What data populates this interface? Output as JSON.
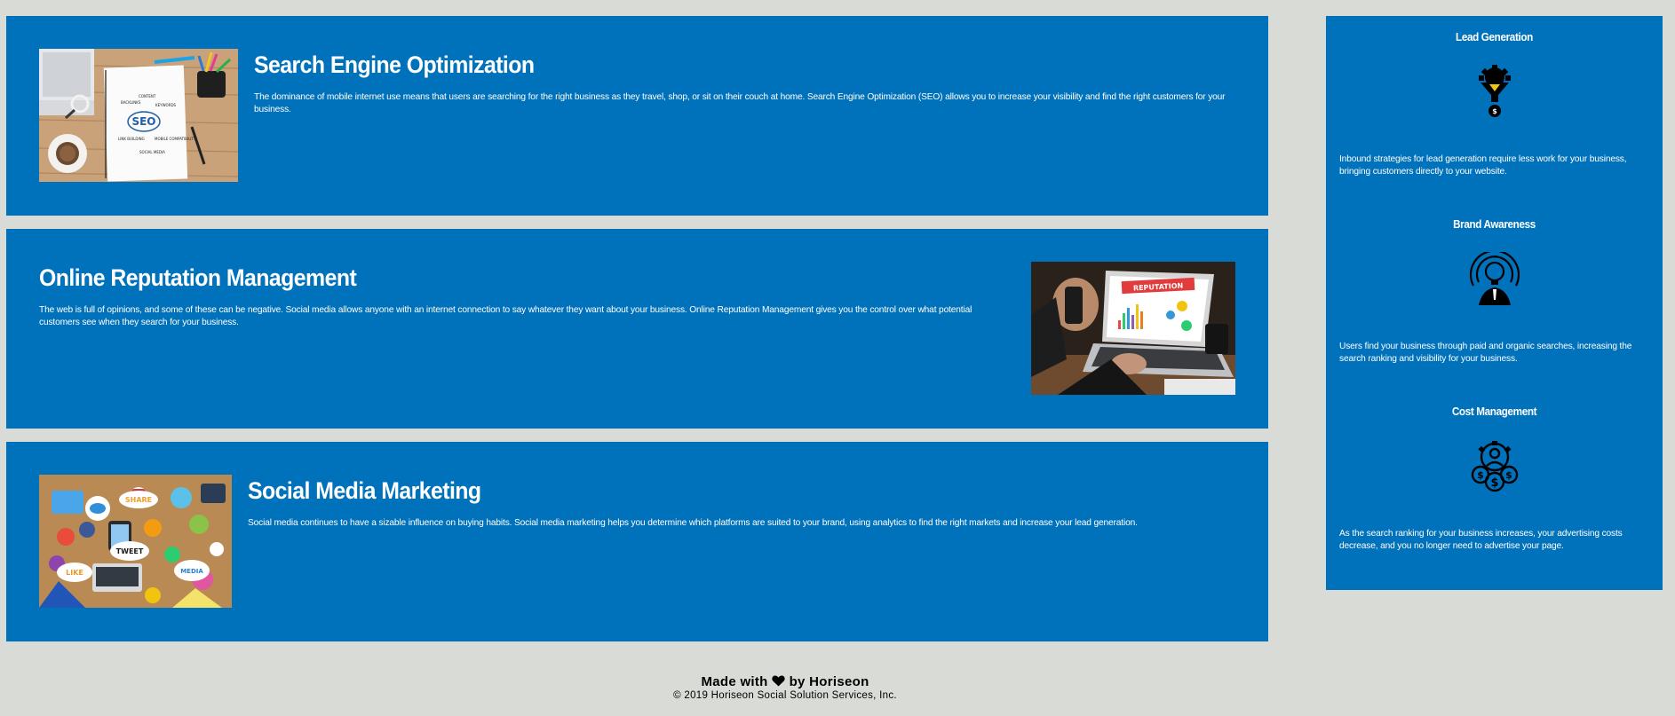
{
  "services": [
    {
      "title": "Search Engine Optimization",
      "description": "The dominance of mobile internet use means that users are searching for the right business as they travel, shop, or sit on their couch at home. Search Engine Optimization (SEO) allows you to increase your visibility and find the right customers for your business.",
      "image_label": "SEO",
      "image_words": [
        "CONTENT",
        "BACKLINKS",
        "KEYWORDS",
        "LINK BUILDING",
        "MOBILE COMPATIBILITY",
        "SOCIAL MEDIA"
      ]
    },
    {
      "title": "Online Reputation Management",
      "description": "The web is full of opinions, and some of these can be negative. Social media allows anyone with an internet connection to say whatever they want about your business. Online Reputation Management gives you the control over what potential customers see when they search for your business.",
      "image_label": "REPUTATION"
    },
    {
      "title": "Social Media Marketing",
      "description": "Social media continues to have a sizable influence on buying habits. Social media marketing helps you determine which platforms are suited to your brand, using analytics to find the right markets and increase your lead generation.",
      "image_bubbles": [
        "SHARE",
        "TWEET",
        "LIKE",
        "MEDIA"
      ]
    }
  ],
  "benefits": [
    {
      "title": "Lead Generation",
      "icon": "lead-generation-icon",
      "description": "Inbound strategies for lead generation require less work for your business, bringing customers directly to your website."
    },
    {
      "title": "Brand Awareness",
      "icon": "brand-awareness-icon",
      "description": "Users find your business through paid and organic searches, increasing the search ranking and visibility for your business."
    },
    {
      "title": "Cost Management",
      "icon": "cost-management-icon",
      "description": "As the search ranking for your business increases, your advertising costs decrease, and you no longer need to advertise your page."
    }
  ],
  "footer": {
    "made_prefix": "Made with",
    "made_suffix": "by Horiseon",
    "copyright": "© 2019 Horiseon Social Solution Services, Inc."
  },
  "colors": {
    "background": "#d9dbd6",
    "card": "#0072bb",
    "text_on_card": "#ffffff",
    "footer_text": "#000000"
  }
}
